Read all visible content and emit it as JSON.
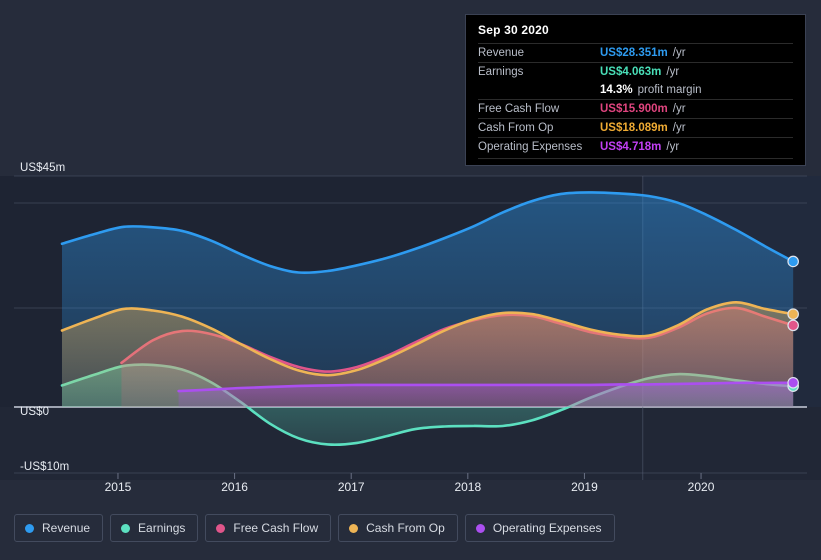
{
  "chart_data": {
    "type": "area",
    "title": "",
    "xlabel": "",
    "ylabel": "",
    "currency_unit": "US$",
    "ylim": [
      -10,
      45
    ],
    "xlim": [
      2014.4,
      2020.9
    ],
    "grid": true,
    "legend_position": "bottom-left",
    "y_ticks": [
      {
        "value": 45,
        "label": "US$45m"
      },
      {
        "value": 0,
        "label": "US$0"
      },
      {
        "value": -10,
        "label": "-US$10m"
      }
    ],
    "x_ticks": [
      {
        "value": 2015,
        "label": "2015"
      },
      {
        "value": 2016,
        "label": "2016"
      },
      {
        "value": 2017,
        "label": "2017"
      },
      {
        "value": 2018,
        "label": "2018"
      },
      {
        "value": 2019,
        "label": "2019"
      },
      {
        "value": 2020,
        "label": "2020"
      }
    ],
    "forecast_boundary": 2019.5,
    "series": [
      {
        "name": "Revenue",
        "color": "#2e9bf0",
        "x": [
          2014.52,
          2014.8,
          2015.05,
          2015.3,
          2015.55,
          2015.8,
          2016.05,
          2016.3,
          2016.55,
          2016.8,
          2017.05,
          2017.3,
          2017.55,
          2017.8,
          2018.05,
          2018.3,
          2018.55,
          2018.8,
          2019.05,
          2019.3,
          2019.55,
          2019.8,
          2020.05,
          2020.3,
          2020.55,
          2020.79
        ],
        "values": [
          31.8,
          33.7,
          35.1,
          35.0,
          34.3,
          32.4,
          29.8,
          27.5,
          26.2,
          26.5,
          27.6,
          29.0,
          30.8,
          32.9,
          35.2,
          37.9,
          40.1,
          41.5,
          41.8,
          41.6,
          41.1,
          39.8,
          37.4,
          34.5,
          31.3,
          28.351
        ]
      },
      {
        "name": "Earnings",
        "color": "#5ce0c0",
        "x": [
          2014.52,
          2014.8,
          2015.05,
          2015.3,
          2015.55,
          2015.8,
          2016.05,
          2016.3,
          2016.55,
          2016.8,
          2017.05,
          2017.3,
          2017.55,
          2017.8,
          2018.05,
          2018.3,
          2018.55,
          2018.8,
          2019.05,
          2019.3,
          2019.55,
          2019.8,
          2020.05,
          2020.3,
          2020.55,
          2020.79
        ],
        "values": [
          4.2,
          6.3,
          8.0,
          8.2,
          7.3,
          4.8,
          1.0,
          -3.2,
          -6.1,
          -7.3,
          -7.0,
          -5.7,
          -4.3,
          -3.8,
          -3.7,
          -3.7,
          -2.6,
          -0.6,
          1.8,
          3.9,
          5.6,
          6.4,
          6.0,
          5.2,
          4.5,
          4.063
        ]
      },
      {
        "name": "Free Cash Flow",
        "color": "#e0558a",
        "x": [
          2015.03,
          2015.3,
          2015.55,
          2015.8,
          2016.05,
          2016.3,
          2016.55,
          2016.8,
          2017.05,
          2017.3,
          2017.55,
          2017.8,
          2018.05,
          2018.3,
          2018.55,
          2018.8,
          2019.05,
          2019.3,
          2019.55,
          2019.8,
          2020.05,
          2020.3,
          2020.55,
          2020.79
        ],
        "values": [
          8.6,
          13.0,
          14.8,
          14.2,
          12.3,
          9.8,
          7.8,
          6.9,
          7.8,
          9.9,
          12.6,
          15.2,
          16.9,
          17.9,
          17.7,
          16.2,
          14.6,
          13.7,
          13.5,
          15.4,
          18.2,
          19.3,
          17.6,
          15.9
        ]
      },
      {
        "name": "Cash From Op",
        "color": "#eeb455",
        "x": [
          2014.52,
          2014.8,
          2015.05,
          2015.3,
          2015.55,
          2015.8,
          2016.05,
          2016.3,
          2016.55,
          2016.8,
          2017.05,
          2017.3,
          2017.55,
          2017.8,
          2018.05,
          2018.3,
          2018.55,
          2018.8,
          2019.05,
          2019.3,
          2019.55,
          2019.8,
          2020.05,
          2020.3,
          2020.55,
          2020.79
        ],
        "values": [
          14.9,
          17.3,
          19.1,
          18.8,
          17.6,
          15.3,
          12.3,
          9.4,
          7.1,
          6.2,
          7.2,
          9.4,
          12.1,
          14.9,
          17.1,
          18.3,
          18.1,
          16.7,
          15.1,
          14.1,
          13.9,
          15.9,
          19.0,
          20.4,
          19.1,
          18.089
        ]
      },
      {
        "name": "Operating Expenses",
        "color": "#ab4ff0",
        "x": [
          2015.52,
          2015.8,
          2016.05,
          2016.3,
          2016.55,
          2016.8,
          2017.05,
          2017.3,
          2017.55,
          2017.8,
          2018.05,
          2018.3,
          2018.55,
          2018.8,
          2019.05,
          2019.3,
          2019.55,
          2019.8,
          2020.05,
          2020.3,
          2020.55,
          2020.79
        ],
        "values": [
          3.1,
          3.4,
          3.7,
          3.9,
          4.1,
          4.2,
          4.3,
          4.3,
          4.3,
          4.3,
          4.3,
          4.3,
          4.3,
          4.3,
          4.3,
          4.4,
          4.4,
          4.5,
          4.6,
          4.7,
          4.7,
          4.718
        ]
      }
    ]
  },
  "tooltip": {
    "date": "Sep 30 2020",
    "rows": [
      {
        "label": "Revenue",
        "value": "US$28.351m",
        "unit": "/yr",
        "color": "#2e9bf0"
      },
      {
        "label": "Earnings",
        "value": "US$4.063m",
        "unit": "/yr",
        "color": "#49dfb8"
      },
      {
        "label": "",
        "value": "14.3%",
        "unit": "profit margin",
        "color": "#ffffff"
      },
      {
        "label": "Free Cash Flow",
        "value": "US$15.900m",
        "unit": "/yr",
        "color": "#e0457f"
      },
      {
        "label": "Cash From Op",
        "value": "US$18.089m",
        "unit": "/yr",
        "color": "#eeaa33"
      },
      {
        "label": "Operating Expenses",
        "value": "US$4.718m",
        "unit": "/yr",
        "color": "#c340f5"
      }
    ]
  },
  "legend": {
    "items": [
      {
        "label": "Revenue",
        "color": "#2e9bf0"
      },
      {
        "label": "Earnings",
        "color": "#5ce0c0"
      },
      {
        "label": "Free Cash Flow",
        "color": "#e0558a"
      },
      {
        "label": "Cash From Op",
        "color": "#eeb455"
      },
      {
        "label": "Operating Expenses",
        "color": "#ab4ff0"
      }
    ]
  }
}
